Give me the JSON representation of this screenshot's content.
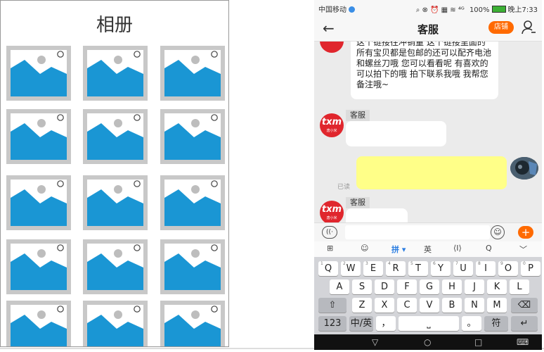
{
  "album": {
    "title": "相册",
    "thumbnails": 15
  },
  "phone": {
    "status": {
      "carrier": "中国移动",
      "icons": "⌕ ⊗ ⏰ ▦ ≋ ⁴ᴳ",
      "battery": "100%",
      "time": "晚上7:33"
    },
    "nav": {
      "back_icon": "←",
      "title": "客服",
      "shop_button": "店铺"
    },
    "messages": {
      "first_text": "这个链接往冲销量 这个链接里面的所有宝贝都是包邮的还可以配齐电池和螺丝刀哦 您可以看看呢 有喜欢的 可以拍下的哦 拍下联系我哦 我帮您备注哦~",
      "sender1": "客服",
      "sender2": "客服",
      "read_label": "已读",
      "avatar_logo": "txm",
      "avatar_sub": "唐小米"
    },
    "input": {
      "voice_icon": "((·",
      "emoji_icon": "☺",
      "plus": "+"
    },
    "ime_bar": {
      "grid": "⊞",
      "emoji": "☺",
      "pinyin": "拼 ▾",
      "english": "英",
      "cursor": "⟨I⟩",
      "search": "Q",
      "collapse": "﹀"
    },
    "keyboard": {
      "row1": [
        "Q",
        "W",
        "E",
        "R",
        "T",
        "Y",
        "U",
        "I",
        "O",
        "P"
      ],
      "row1_nums": [
        "1",
        "2",
        "3",
        "4",
        "5",
        "6",
        "7",
        "8",
        "9",
        "0"
      ],
      "row2": [
        "A",
        "S",
        "D",
        "F",
        "G",
        "H",
        "J",
        "K",
        "L"
      ],
      "row3": [
        "Z",
        "X",
        "C",
        "V",
        "B",
        "N",
        "M"
      ],
      "shift": "⇧",
      "delete": "⌫",
      "num": "123",
      "lang": "中/英",
      "comma": "，",
      "space": "⎵",
      "period": "。",
      "symbol": "符",
      "enter": "↵"
    },
    "sysnav": {
      "down": "▽",
      "home": "○",
      "recent": "□",
      "keyboard": "⌨"
    }
  }
}
